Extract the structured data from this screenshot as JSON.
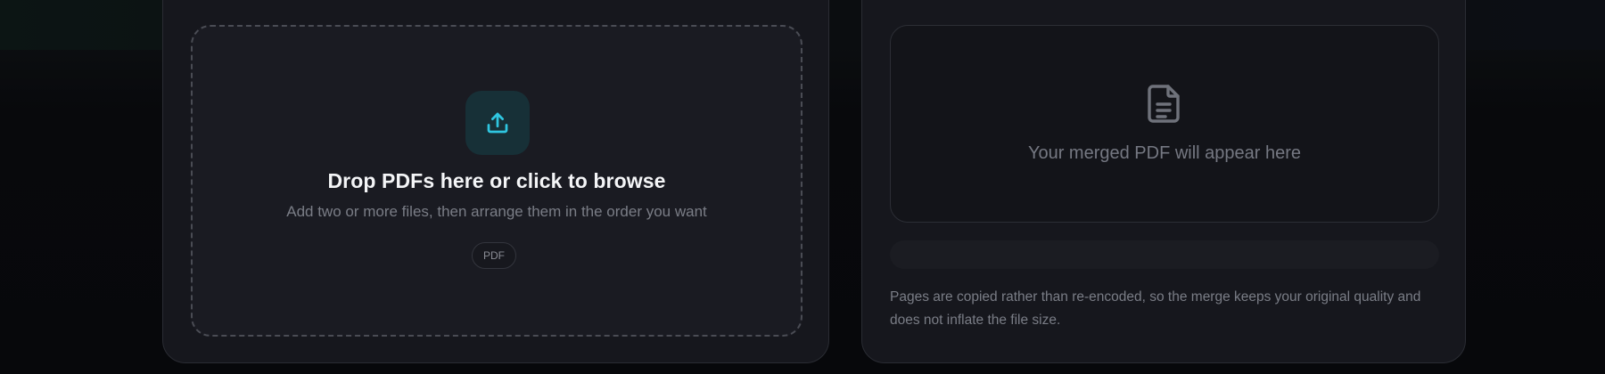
{
  "upload": {
    "title": "Drop PDFs here or click to browse",
    "subtitle": "Add two or more files, then arrange them in the order you want",
    "format_chip": "PDF",
    "icon": "upload-icon",
    "accent_color": "#2fc6e0"
  },
  "result": {
    "placeholder_text": "Your merged PDF will appear here",
    "icon": "document-icon",
    "progress": 0,
    "note": "Pages are copied rather than re-encoded, so the merge keeps your original quality and does not inflate the file size."
  }
}
